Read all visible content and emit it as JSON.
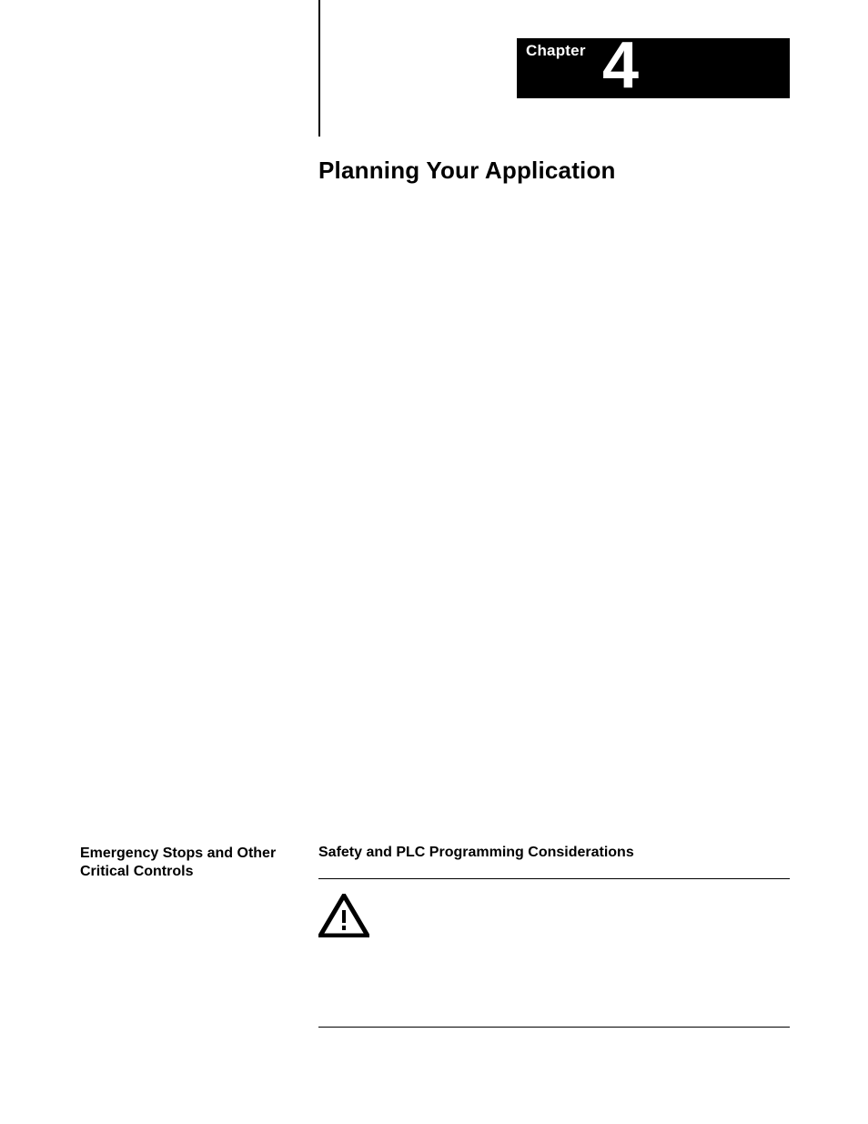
{
  "chapter": {
    "label": "Chapter",
    "number": "4"
  },
  "title": "Planning Your Application",
  "left_heading": "Emergency Stops and Other Critical Controls",
  "right_heading": "Safety and PLC Programming Considerations",
  "icons": {
    "warning": "attention-triangle"
  }
}
